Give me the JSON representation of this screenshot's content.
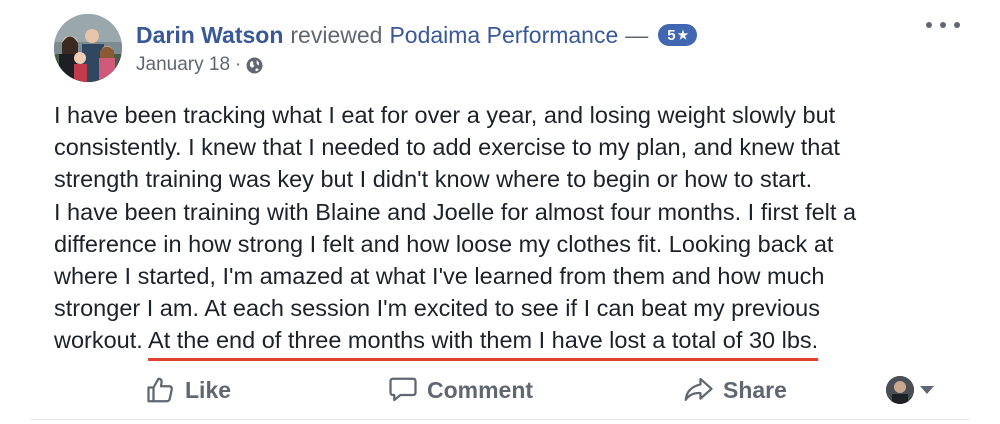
{
  "post": {
    "author": "Darin Watson",
    "verb": "reviewed",
    "page_name": "Podaima Performance",
    "dash": "—",
    "rating": "5",
    "rating_star": "★",
    "date": "January 18",
    "meta_separator": "·",
    "privacy_icon": "globe-icon",
    "more_icon": "ellipsis-icon"
  },
  "review": {
    "lines": [
      "I have been tracking what I eat for over a year, and losing weight slowly but",
      "consistently. I knew that I needed to add exercise to my plan, and knew that",
      "strength training was key but I didn't know where to begin or how to start.",
      "I have been training with Blaine and Joelle for almost four months. I first felt a",
      "difference in how strong I felt and how loose my clothes fit. Looking back at",
      "where I started, I'm amazed at what I've learned from them and how much",
      "stronger I am. At each session I'm excited to see if I can beat my previous"
    ],
    "last_line_start": "workout. ",
    "last_line_highlight": "At the end of three months with them I have lost a total of 30 lbs.",
    "highlight_color": "#e0432e"
  },
  "actions": {
    "like_label": "Like",
    "comment_label": "Comment",
    "share_label": "Share",
    "like_icon": "thumbs-up-icon",
    "comment_icon": "speech-bubble-icon",
    "share_icon": "share-arrow-icon"
  },
  "colors": {
    "link_blue": "#385898",
    "badge_blue": "#4267b2",
    "text": "#1d2129",
    "secondary_text": "#616770"
  }
}
